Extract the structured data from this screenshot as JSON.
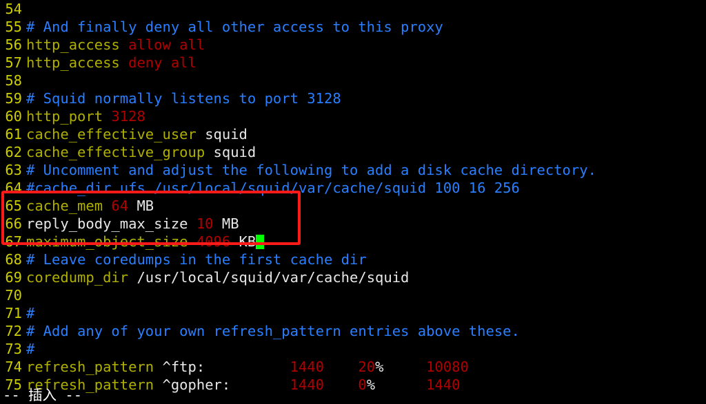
{
  "app": {
    "type": "terminal-text-editor",
    "editor": "vim",
    "background_color": "#000000"
  },
  "colors": {
    "line_number": "#cdcd00",
    "comment": "#2a7fff",
    "keyword": "#b0b000",
    "number": "#b00000",
    "plain_text": "#e8e8e8",
    "cursor": "#00ff00",
    "annotation": "#ff1a1a"
  },
  "lines": [
    {
      "num": "54",
      "tokens": []
    },
    {
      "num": "55",
      "tokens": [
        {
          "t": "# And finally deny all other access to this proxy",
          "c": "comment"
        }
      ]
    },
    {
      "num": "56",
      "tokens": [
        {
          "t": "http_access ",
          "c": "keyword"
        },
        {
          "t": "allow all",
          "c": "number"
        }
      ]
    },
    {
      "num": "57",
      "tokens": [
        {
          "t": "http_access ",
          "c": "keyword"
        },
        {
          "t": "deny all",
          "c": "number"
        }
      ]
    },
    {
      "num": "58",
      "tokens": []
    },
    {
      "num": "59",
      "tokens": [
        {
          "t": "# Squid normally listens to port 3128",
          "c": "comment"
        }
      ]
    },
    {
      "num": "60",
      "tokens": [
        {
          "t": "http_port ",
          "c": "keyword"
        },
        {
          "t": "3128",
          "c": "number"
        }
      ]
    },
    {
      "num": "61",
      "tokens": [
        {
          "t": "cache_effective_user ",
          "c": "keyword"
        },
        {
          "t": "squid",
          "c": "plain"
        }
      ]
    },
    {
      "num": "62",
      "tokens": [
        {
          "t": "cache_effective_group ",
          "c": "keyword"
        },
        {
          "t": "squid",
          "c": "plain"
        }
      ]
    },
    {
      "num": "63",
      "tokens": [
        {
          "t": "# Uncomment and adjust the following to add a disk cache directory.",
          "c": "comment"
        }
      ]
    },
    {
      "num": "64",
      "tokens": [
        {
          "t": "#cache_dir ufs /usr/local/squid/var/cache/squid 100 16 256",
          "c": "comment"
        }
      ]
    },
    {
      "num": "65",
      "tokens": [
        {
          "t": "cache_mem ",
          "c": "keyword"
        },
        {
          "t": "64",
          "c": "number"
        },
        {
          "t": " MB",
          "c": "plain"
        }
      ]
    },
    {
      "num": "66",
      "tokens": [
        {
          "t": "reply_body_max_size ",
          "c": "plain"
        },
        {
          "t": "10",
          "c": "number"
        },
        {
          "t": " MB",
          "c": "plain"
        }
      ]
    },
    {
      "num": "67",
      "tokens": [
        {
          "t": "maximum_object_size ",
          "c": "keyword"
        },
        {
          "t": "4096",
          "c": "number"
        },
        {
          "t": " KB",
          "c": "plain"
        }
      ],
      "cursor": true
    },
    {
      "num": "68",
      "tokens": [
        {
          "t": "# Leave coredumps in the first cache dir",
          "c": "comment"
        }
      ]
    },
    {
      "num": "69",
      "tokens": [
        {
          "t": "coredump_dir ",
          "c": "keyword"
        },
        {
          "t": "/usr/local/squid/var/cache/squid",
          "c": "plain"
        }
      ]
    },
    {
      "num": "70",
      "tokens": []
    },
    {
      "num": "71",
      "tokens": [
        {
          "t": "#",
          "c": "comment"
        }
      ]
    },
    {
      "num": "72",
      "tokens": [
        {
          "t": "# Add any of your own refresh_pattern entries above these.",
          "c": "comment"
        }
      ]
    },
    {
      "num": "73",
      "tokens": [
        {
          "t": "#",
          "c": "comment"
        }
      ]
    },
    {
      "num": "74",
      "tokens": [
        {
          "t": "refresh_pattern ",
          "c": "keyword"
        },
        {
          "t": "^ftp:",
          "c": "plain"
        },
        {
          "t": "          ",
          "c": "plain"
        },
        {
          "t": "1440",
          "c": "number"
        },
        {
          "t": "    ",
          "c": "plain"
        },
        {
          "t": "20",
          "c": "number"
        },
        {
          "t": "%",
          "c": "plain"
        },
        {
          "t": "     ",
          "c": "plain"
        },
        {
          "t": "10080",
          "c": "number"
        }
      ]
    },
    {
      "num": "75",
      "tokens": [
        {
          "t": "refresh_pattern ",
          "c": "keyword"
        },
        {
          "t": "^gopher:",
          "c": "plain"
        },
        {
          "t": "       ",
          "c": "plain"
        },
        {
          "t": "1440",
          "c": "number"
        },
        {
          "t": "    ",
          "c": "plain"
        },
        {
          "t": "0",
          "c": "number"
        },
        {
          "t": "%",
          "c": "plain"
        },
        {
          "t": "      ",
          "c": "plain"
        },
        {
          "t": "1440",
          "c": "number"
        }
      ]
    }
  ],
  "status": {
    "text": "-- 插入 --"
  },
  "annotation": {
    "label": "highlight-box-lines-65-67",
    "covers_lines": [
      "65",
      "66",
      "67"
    ]
  }
}
